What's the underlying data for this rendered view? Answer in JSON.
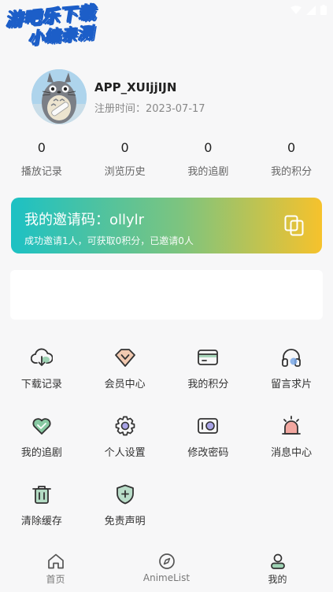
{
  "watermark": {
    "line1": "游吧乐下载",
    "line2": "小编亲测"
  },
  "profile": {
    "username": "APP_XUIjjIJN",
    "reg_label": "注册时间：",
    "reg_date": "2023-07-17"
  },
  "stats": [
    {
      "value": "0",
      "label": "播放记录"
    },
    {
      "value": "0",
      "label": "浏览历史"
    },
    {
      "value": "0",
      "label": "我的追剧"
    },
    {
      "value": "0",
      "label": "我的积分"
    }
  ],
  "invite": {
    "title": "我的邀请码：ollylr",
    "subtitle": "成功邀请1人，可获取0积分，已邀请0人",
    "icon": "copy-icon"
  },
  "menu": [
    {
      "label": "下载记录",
      "icon": "cloud-download-icon"
    },
    {
      "label": "会员中心",
      "icon": "vip-badge-icon"
    },
    {
      "label": "我的积分",
      "icon": "wallet-icon"
    },
    {
      "label": "留言求片",
      "icon": "headphones-icon"
    },
    {
      "label": "我的追剧",
      "icon": "heart-icon"
    },
    {
      "label": "个人设置",
      "icon": "gear-icon"
    },
    {
      "label": "修改密码",
      "icon": "lock-toggle-icon"
    },
    {
      "label": "消息中心",
      "icon": "alarm-icon"
    },
    {
      "label": "清除缓存",
      "icon": "trash-icon"
    },
    {
      "label": "免责声明",
      "icon": "shield-plus-icon"
    }
  ],
  "tabs": [
    {
      "label": "首页",
      "icon": "home-icon",
      "active": false
    },
    {
      "label": "AnimeList",
      "icon": "compass-icon",
      "active": false
    },
    {
      "label": "我的",
      "icon": "user-icon",
      "active": true
    }
  ],
  "colors": {
    "accent_teal": "#1cc1c4",
    "accent_yellow": "#f6c22c",
    "icon_accent": "#87c9a2",
    "icon_stroke": "#333333"
  }
}
